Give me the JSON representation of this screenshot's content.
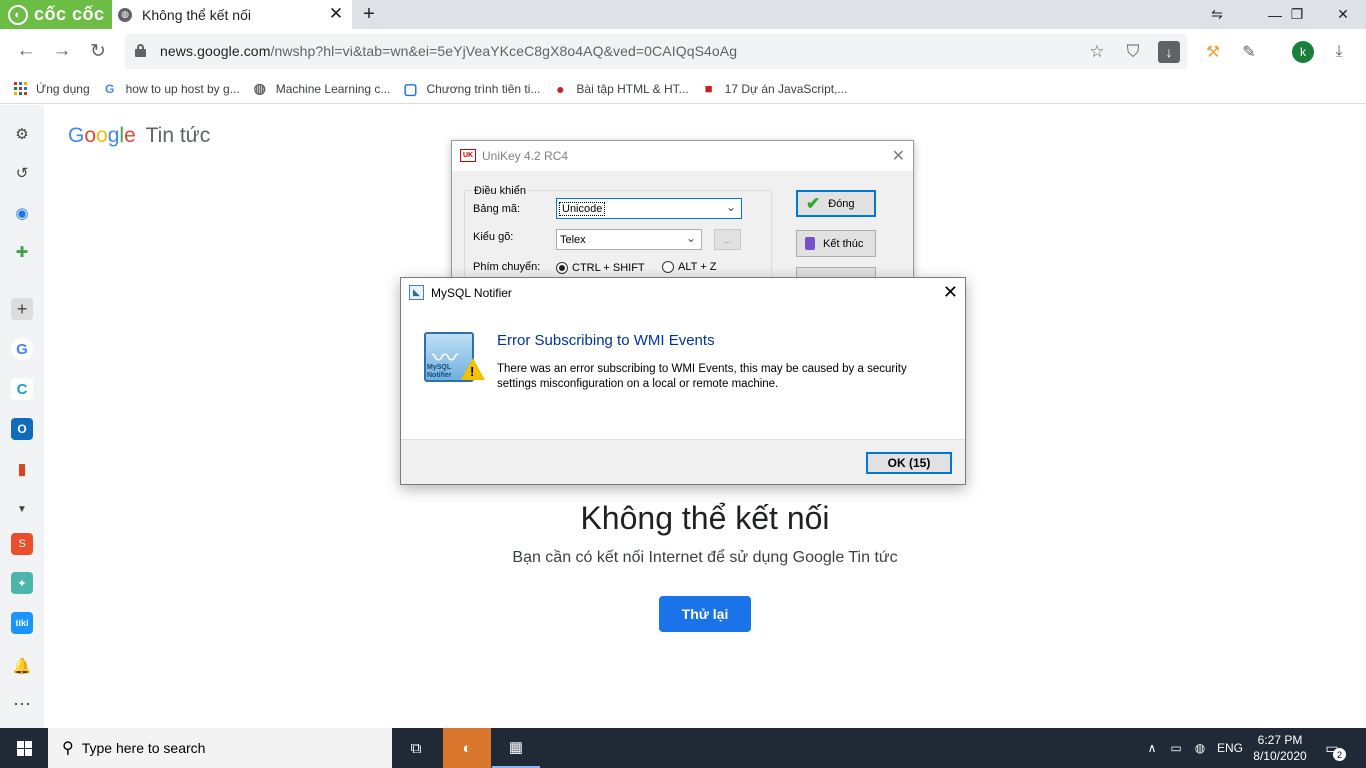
{
  "browser": {
    "brand": "cốc cốc",
    "tab_title": "Không thể kết nối",
    "url_host": "news.google.com",
    "url_path": "/nwshp?hl=vi&tab=wn&ei=5eYjVeaYKceC8gX8o4AQ&ved=0CAIQqS4oAg",
    "avatar_letter": "k"
  },
  "bookmarks": [
    {
      "label": "Ứng dụng"
    },
    {
      "label": "how to up host by g..."
    },
    {
      "label": "Machine Learning c..."
    },
    {
      "label": "Chương trình tiên ti..."
    },
    {
      "label": "Bài tập HTML & HT..."
    },
    {
      "label": "17 Dự án JavaScript,..."
    }
  ],
  "page": {
    "logo": "Google",
    "logo_suffix": "Tin tức",
    "error_title": "Không thể kết nối",
    "error_subtitle": "Bạn cần có kết nối Internet để sử dụng Google Tin tức",
    "retry_label": "Thử lại"
  },
  "unikey": {
    "title": "UniKey 4.2 RC4",
    "group_label": "Điều khiển",
    "charset_label": "Bảng mã:",
    "charset_value": "Unicode",
    "input_label": "Kiểu gõ:",
    "input_value": "Telex",
    "more_btn": "...",
    "switch_label": "Phím chuyển:",
    "radio_1": "CTRL + SHIFT",
    "radio_2": "ALT + Z",
    "close_btn": "Đóng",
    "exit_btn": "Kết thúc"
  },
  "mysql_dialog": {
    "title": "MySQL Notifier",
    "icon_label_1": "MySQL",
    "icon_label_2": "Notifier",
    "heading": "Error Subscribing to WMI Events",
    "message": "There was an error subscribing to WMI Events, this may be caused by a security settings misconfiguration on a local or remote machine.",
    "ok_label": "OK (15)"
  },
  "taskbar": {
    "search_placeholder": "Type here to search",
    "language": "ENG",
    "time": "6:27 PM",
    "date": "8/10/2020",
    "notification_count": "2"
  }
}
